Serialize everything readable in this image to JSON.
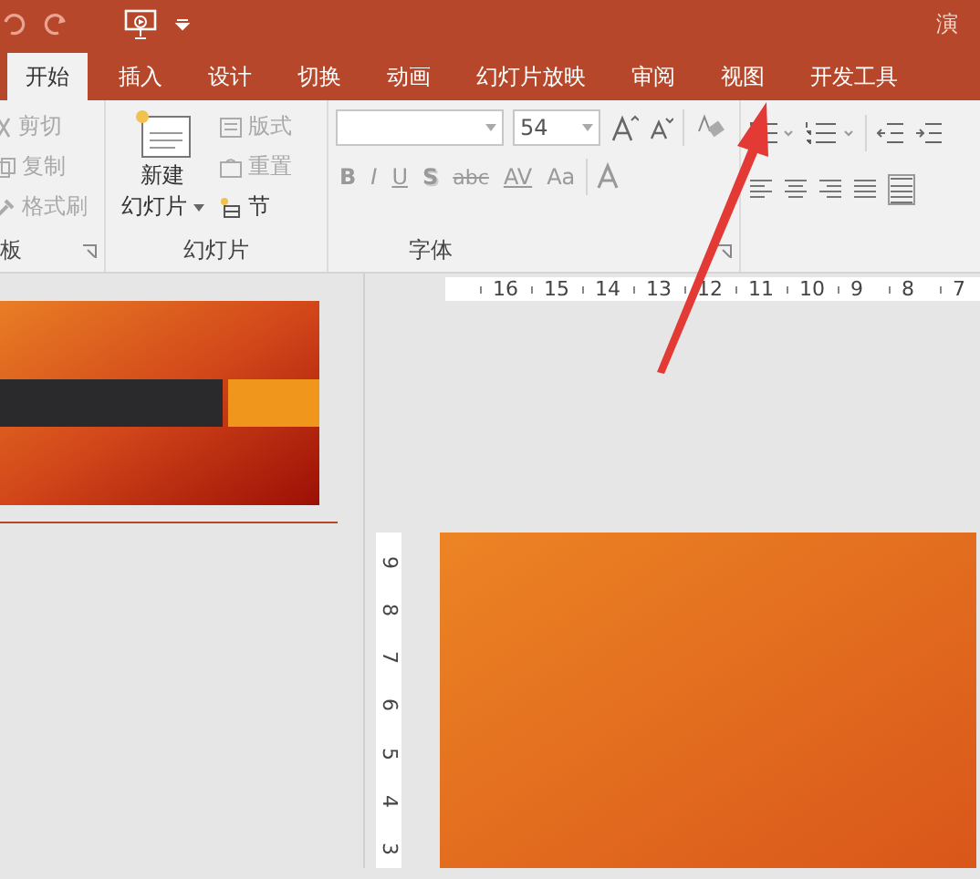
{
  "window": {
    "title": "演"
  },
  "tabs": [
    {
      "label": "开始",
      "selected": true
    },
    {
      "label": "插入",
      "selected": false
    },
    {
      "label": "设计",
      "selected": false
    },
    {
      "label": "切换",
      "selected": false
    },
    {
      "label": "动画",
      "selected": false
    },
    {
      "label": "幻灯片放映",
      "selected": false
    },
    {
      "label": "审阅",
      "selected": false
    },
    {
      "label": "视图",
      "selected": false
    },
    {
      "label": "开发工具",
      "selected": false
    }
  ],
  "clipboard": {
    "items": [
      {
        "label": "剪切",
        "kind": "scissors",
        "disabled": true
      },
      {
        "label": "复制",
        "kind": "copy",
        "disabled": true
      },
      {
        "label": "格式刷",
        "kind": "brush",
        "disabled": true
      }
    ],
    "group_label": "板"
  },
  "slides_group": {
    "new_slide": {
      "line1": "新建",
      "line2": "幻灯片"
    },
    "items": [
      {
        "label": "版式",
        "kind": "layout",
        "disabled": true
      },
      {
        "label": "重置",
        "kind": "reset",
        "disabled": true
      },
      {
        "label": "节",
        "kind": "section",
        "disabled": false
      }
    ],
    "group_label": "幻灯片"
  },
  "font_group": {
    "font_size": "54",
    "format_buttons": [
      {
        "label": "B",
        "kind": "bold"
      },
      {
        "label": "I",
        "kind": "italic"
      },
      {
        "label": "U",
        "kind": "underline"
      },
      {
        "label": "S",
        "kind": "shadow"
      },
      {
        "label": "abc",
        "kind": "strike"
      },
      {
        "label": "AV",
        "kind": "spacing"
      },
      {
        "label": "Aa",
        "kind": "case"
      }
    ],
    "group_label": "字体"
  },
  "ruler": {
    "horizontal": [
      "16",
      "15",
      "14",
      "13",
      "12",
      "11",
      "10",
      "9",
      "8",
      "7"
    ],
    "vertical": [
      "9",
      "8",
      "7",
      "6",
      "5",
      "4",
      "3"
    ]
  }
}
